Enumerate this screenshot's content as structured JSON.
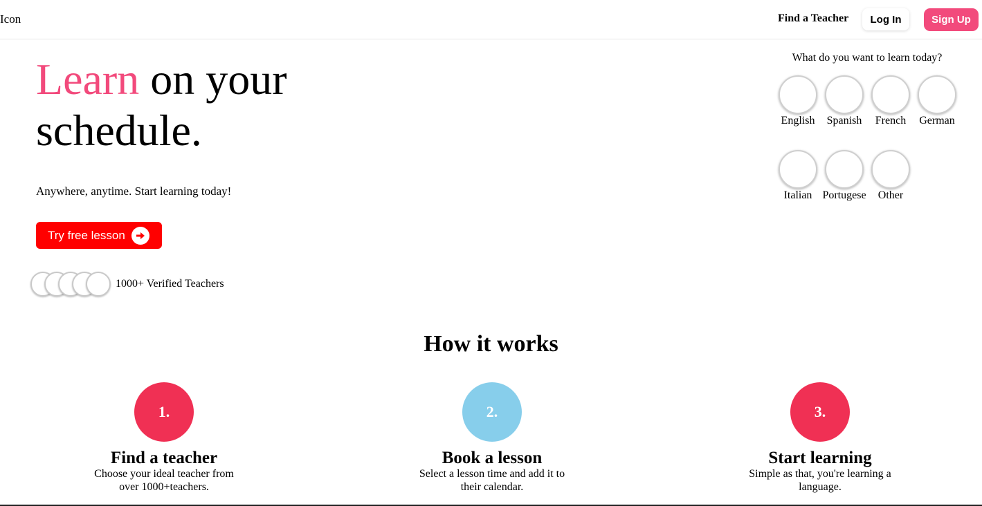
{
  "header": {
    "logo": "Icon",
    "find_teacher": "Find a Teacher",
    "login": "Log In",
    "signup": "Sign Up"
  },
  "hero": {
    "title_accent": "Learn",
    "title_rest": " on your schedule.",
    "subtitle": "Anywhere, anytime. Start learning today!",
    "cta": "Try free lesson",
    "teachers_count": "1000+ Verified Teachers"
  },
  "languages": {
    "question": "What do you want to learn today?",
    "items": [
      {
        "label": "English"
      },
      {
        "label": "Spanish"
      },
      {
        "label": "French"
      },
      {
        "label": "German"
      },
      {
        "label": "Italian"
      },
      {
        "label": "Portugese"
      },
      {
        "label": "Other"
      }
    ]
  },
  "how_it_works": {
    "title": "How it works",
    "steps": [
      {
        "num": "1.",
        "title": "Find a teacher",
        "desc": "Choose your ideal teacher from over 1000+teachers.",
        "color": "#f03054"
      },
      {
        "num": "2.",
        "title": "Book a lesson",
        "desc": "Select a lesson time and add it to their calendar.",
        "color": "#87ceeb"
      },
      {
        "num": "3.",
        "title": "Start learning",
        "desc": "Simple as that, you're learning a language.",
        "color": "#f03054"
      }
    ]
  },
  "colors": {
    "accent": "#f24a7c",
    "cta": "#ff0000"
  }
}
